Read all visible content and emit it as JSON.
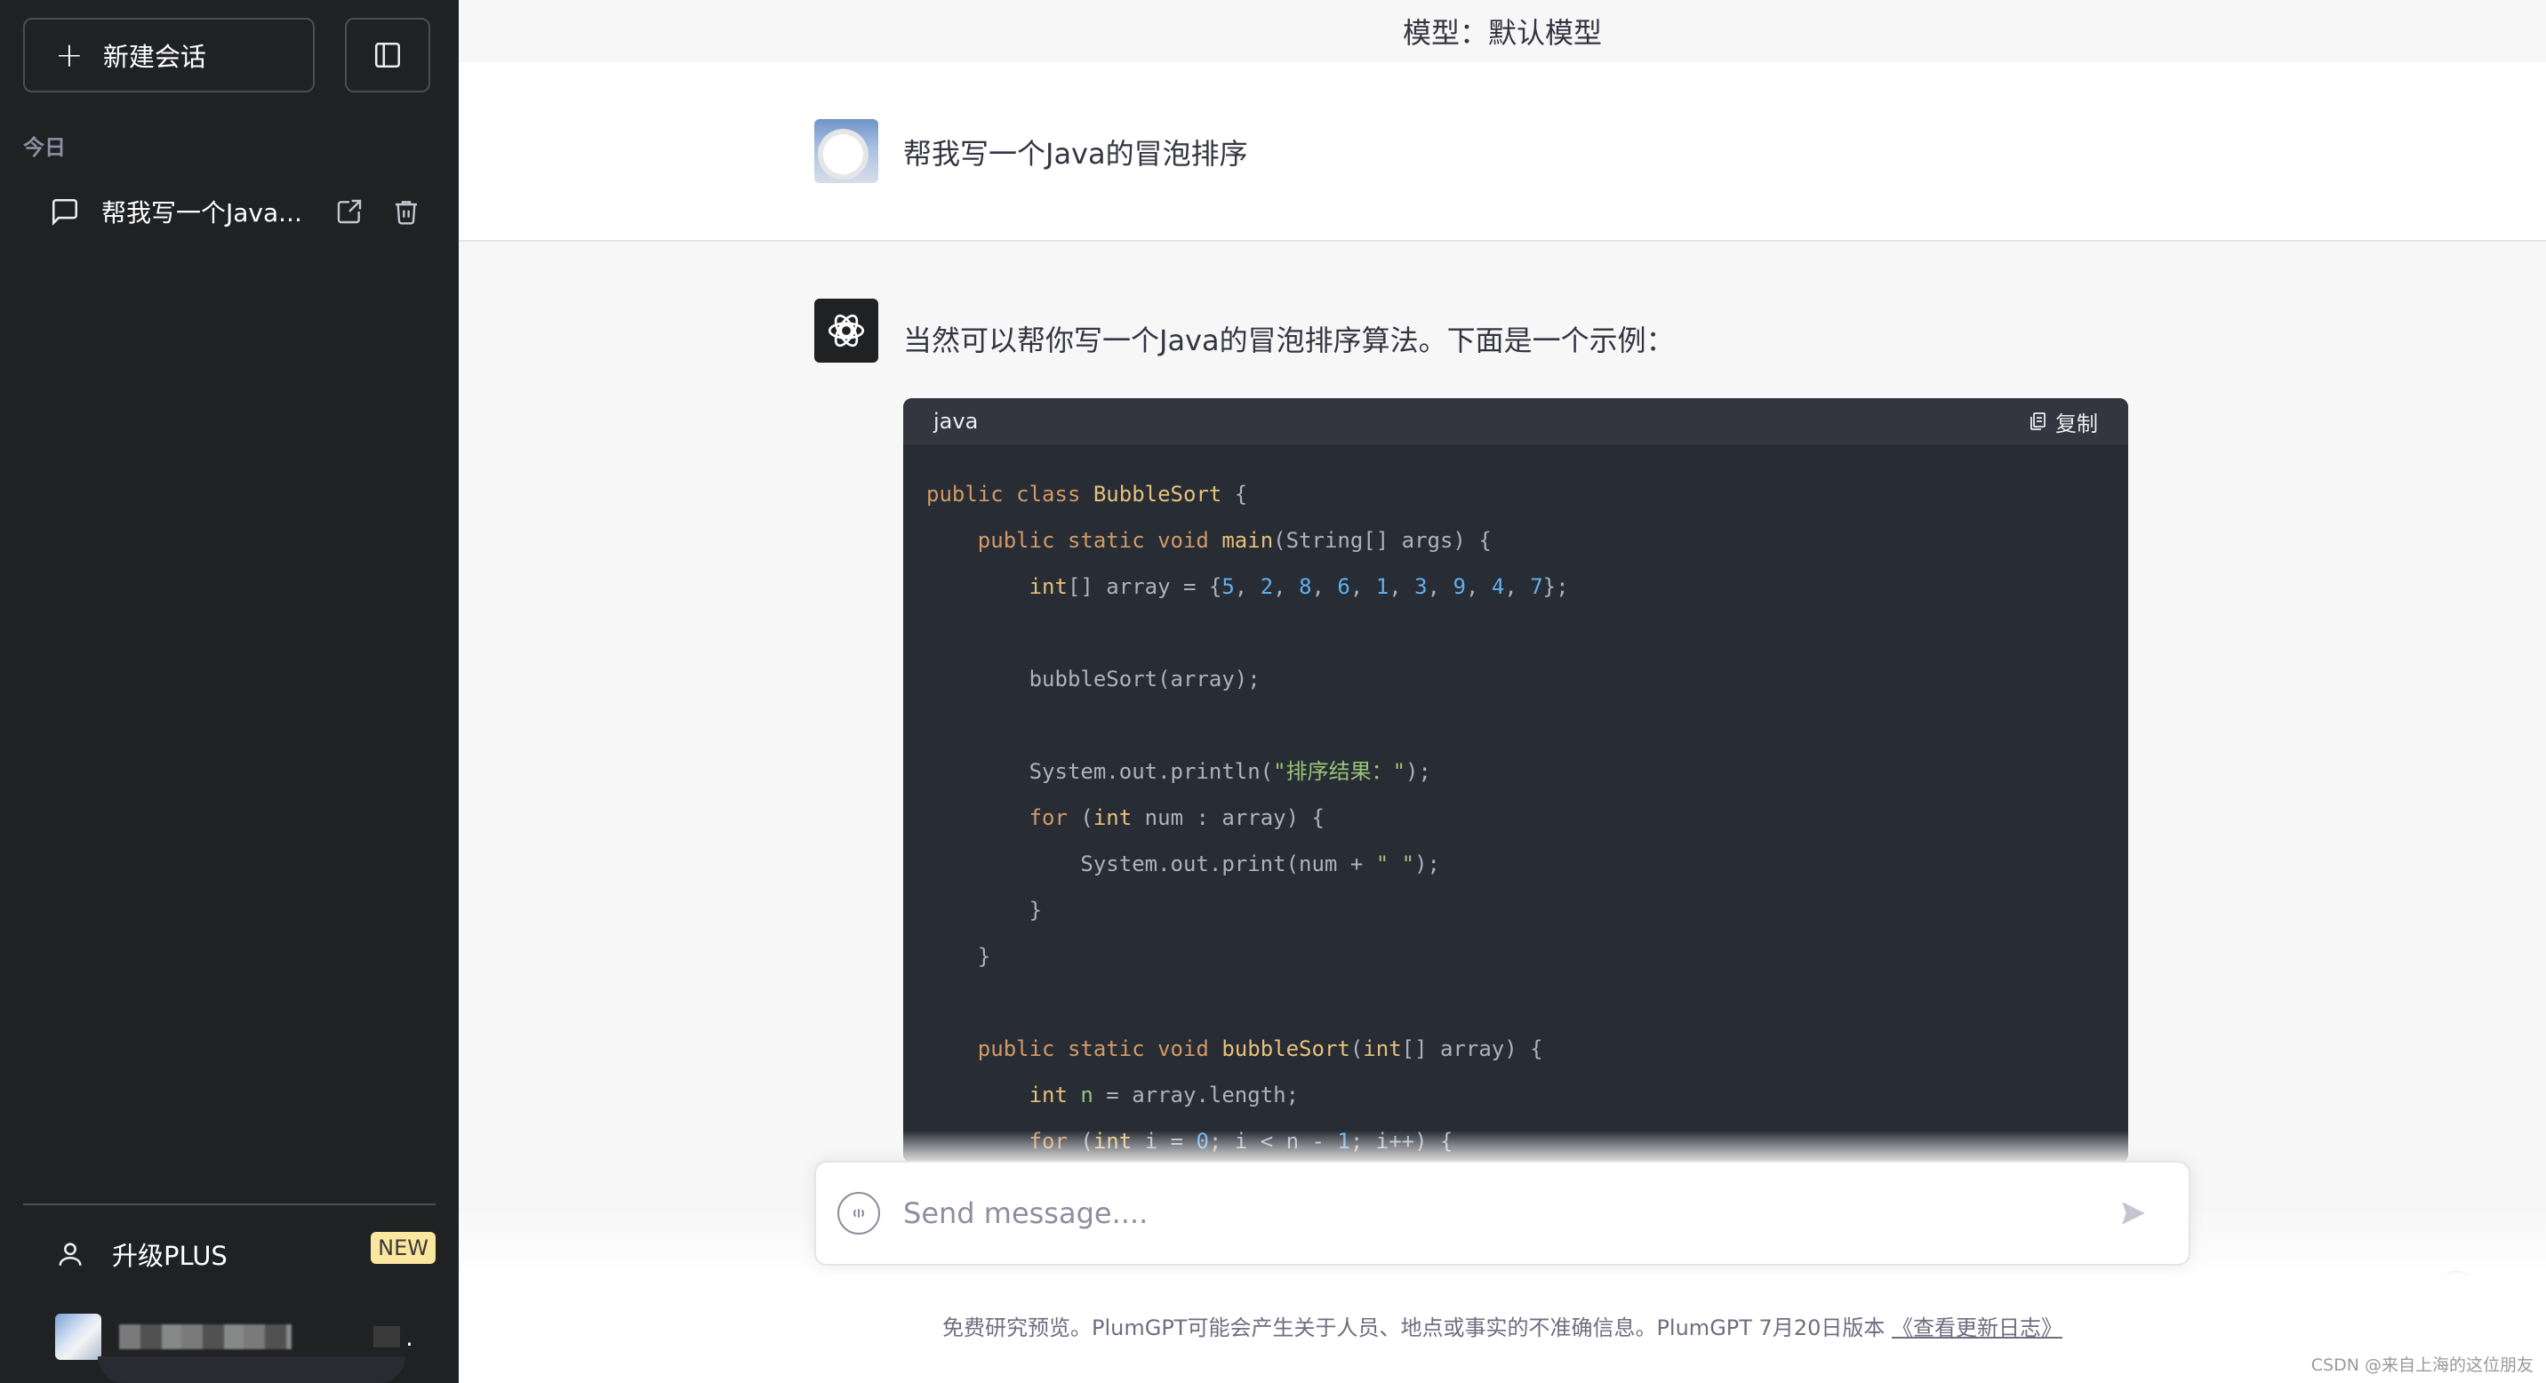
{
  "sidebar": {
    "new_chat_label": "新建会话",
    "section_today": "今日",
    "conversations": [
      {
        "title": "帮我写一个Java..."
      }
    ],
    "upgrade_label": "升级PLUS",
    "new_badge": "NEW"
  },
  "header": {
    "model_label": "模型：默认模型"
  },
  "chat": {
    "user_message": "帮我写一个Java的冒泡排序",
    "bot_intro": "当然可以帮你写一个Java的冒泡排序算法。下面是一个示例：",
    "code": {
      "language": "java",
      "copy_label": "复制"
    }
  },
  "composer": {
    "placeholder": "Send message...."
  },
  "footer": {
    "disclaimer": "免费研究预览。PlumGPT可能会产生关于人员、地点或事实的不准确信息。PlumGPT 7月20日版本",
    "changelog_link": "《查看更新日志》"
  },
  "watermark": "CSDN @来自上海的这位朋友",
  "colors": {
    "sidebar_bg": "#202123",
    "code_bg": "#282c34",
    "badge_bg": "#fae69e"
  }
}
